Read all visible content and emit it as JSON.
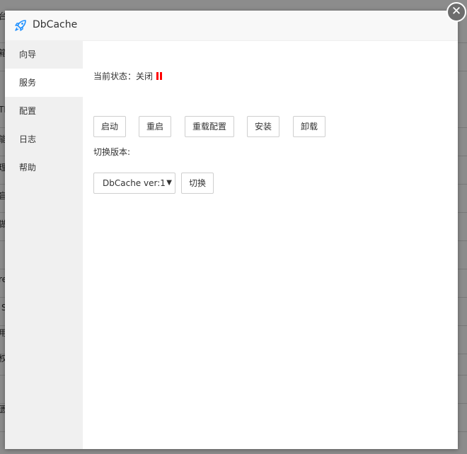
{
  "background": {
    "row_chars": [
      "台",
      "",
      "箱",
      "",
      "TI",
      "",
      "能",
      "",
      "理",
      "",
      "盲",
      "",
      "做",
      "",
      "",
      "",
      "re",
      "",
      "S",
      "",
      "用",
      "",
      "权",
      "",
      "",
      "",
      "匮"
    ]
  },
  "dialog": {
    "title": "DbCache",
    "title_icon": "rocket-icon",
    "close_symbol": "✕"
  },
  "sidebar": {
    "items": [
      {
        "label": "向导"
      },
      {
        "label": "服务",
        "active": true
      },
      {
        "label": "配置"
      },
      {
        "label": "日志"
      },
      {
        "label": "帮助"
      }
    ]
  },
  "content": {
    "status_label": "当前状态：关闭",
    "status_icon": "pause-icon",
    "status_color": "#ff0000",
    "buttons": {
      "start": "启动",
      "restart": "重启",
      "reload": "重载配置",
      "install": "安装",
      "uninstall": "卸载"
    },
    "switch_version_label": "切换版本:",
    "version_select": {
      "selected": "DbCache ver:1"
    },
    "switch_button": "切换"
  }
}
